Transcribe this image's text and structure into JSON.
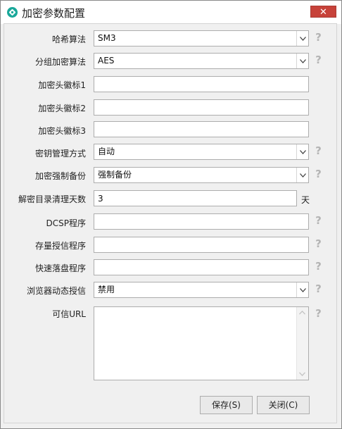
{
  "window": {
    "title": "加密参数配置",
    "close_label": "✕"
  },
  "form": {
    "hash_algorithm": {
      "label": "哈希算法",
      "value": "SM3"
    },
    "block_cipher": {
      "label": "分组加密算法",
      "value": "AES"
    },
    "header_flag_1": {
      "label": "加密头徽标1",
      "value": ""
    },
    "header_flag_2": {
      "label": "加密头徽标2",
      "value": ""
    },
    "header_flag_3": {
      "label": "加密头徽标3",
      "value": ""
    },
    "key_management": {
      "label": "密钥管理方式",
      "value": "自动"
    },
    "forced_backup": {
      "label": "加密强制备份",
      "value": "强制备份"
    },
    "cleanup_days": {
      "label": "解密目录清理天数",
      "value": "3",
      "unit": "天"
    },
    "dcsp_program": {
      "label": "DCSP程序",
      "value": ""
    },
    "stock_auth_program": {
      "label": "存量授信程序",
      "value": ""
    },
    "fast_flush_program": {
      "label": "快速落盘程序",
      "value": ""
    },
    "browser_dynamic_auth": {
      "label": "浏览器动态授信",
      "value": "禁用"
    },
    "trusted_url": {
      "label": "可信URL",
      "value": ""
    }
  },
  "help_glyph": "?",
  "buttons": {
    "save": "保存(S)",
    "close": "关闭(C)"
  },
  "colors": {
    "close_button": "#c7423a",
    "app_icon": "#1aa89a",
    "help_icon": "#b4b4b4"
  }
}
